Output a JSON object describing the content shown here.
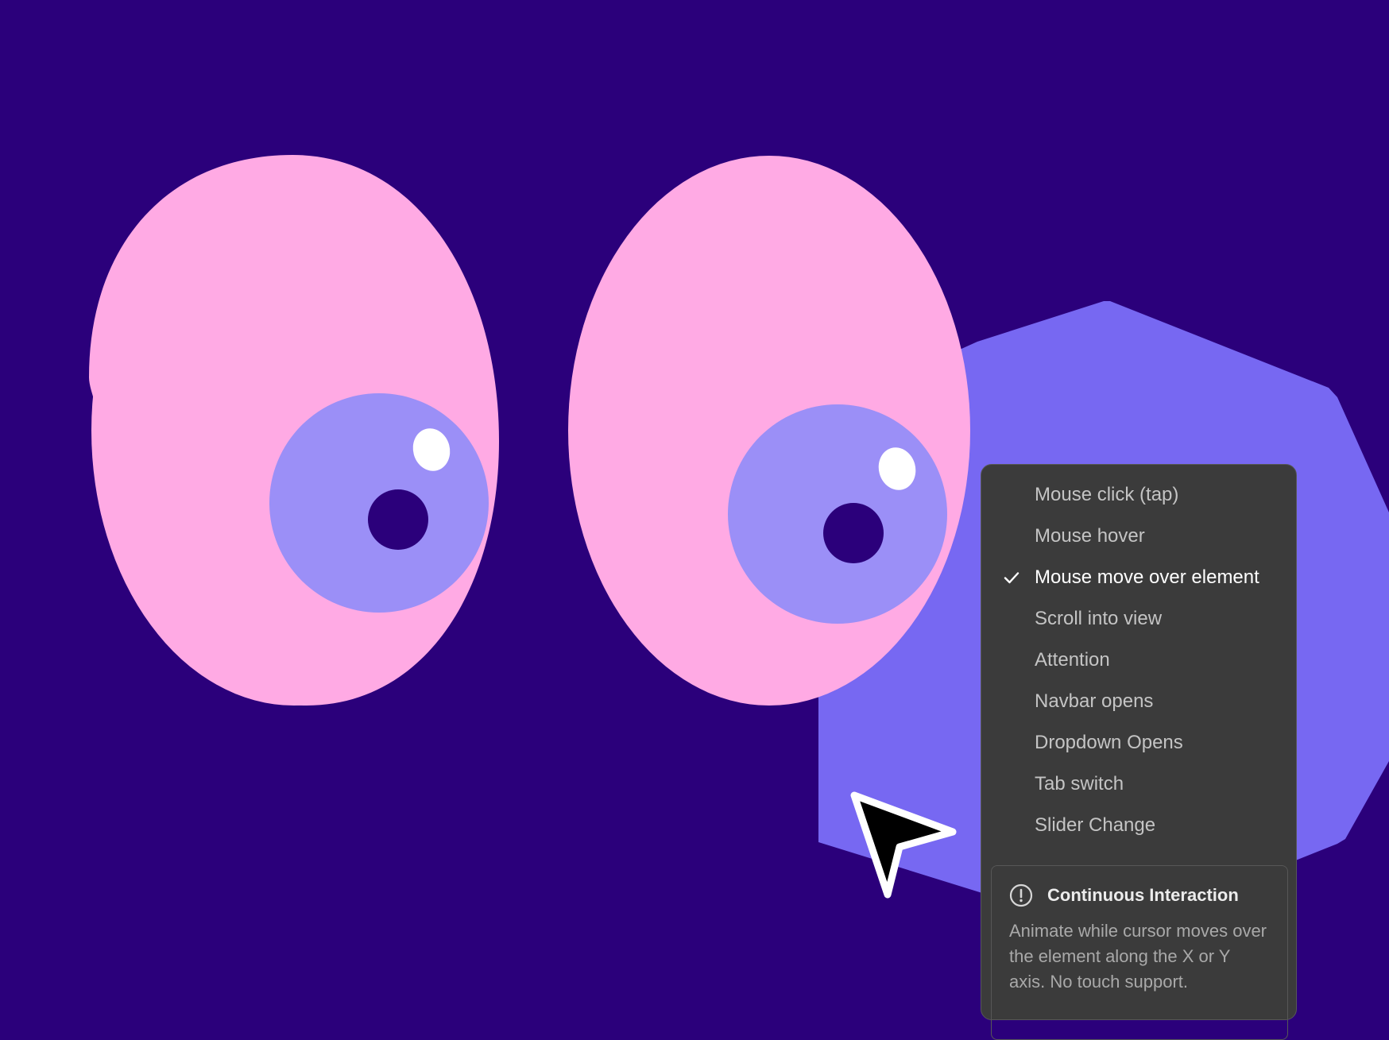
{
  "colors": {
    "background": "#2b007b",
    "eye_white": "#ffaae4",
    "iris": "#9b8ff7",
    "pupil": "#2b007b",
    "highlight": "#ffffff",
    "shape": "#7768f2",
    "menu_bg": "#3b3b3b",
    "menu_text": "#c4c4c4",
    "menu_text_selected": "#ffffff"
  },
  "trigger_menu": {
    "items": [
      {
        "label": "Mouse click (tap)",
        "selected": false
      },
      {
        "label": "Mouse hover",
        "selected": false
      },
      {
        "label": "Mouse move over element",
        "selected": true
      },
      {
        "label": "Scroll into view",
        "selected": false
      },
      {
        "label": "Attention",
        "selected": false
      },
      {
        "label": "Navbar opens",
        "selected": false
      },
      {
        "label": "Dropdown Opens",
        "selected": false
      },
      {
        "label": "Tab switch",
        "selected": false
      },
      {
        "label": "Slider Change",
        "selected": false
      }
    ],
    "selected_icon": "checkmark-icon",
    "info": {
      "icon": "exclamation-circle-icon",
      "title": "Continuous Interaction",
      "description": "Animate while cursor moves over the element along the X or Y axis. No touch support."
    }
  },
  "cursor": {
    "icon": "arrow-cursor-icon"
  }
}
